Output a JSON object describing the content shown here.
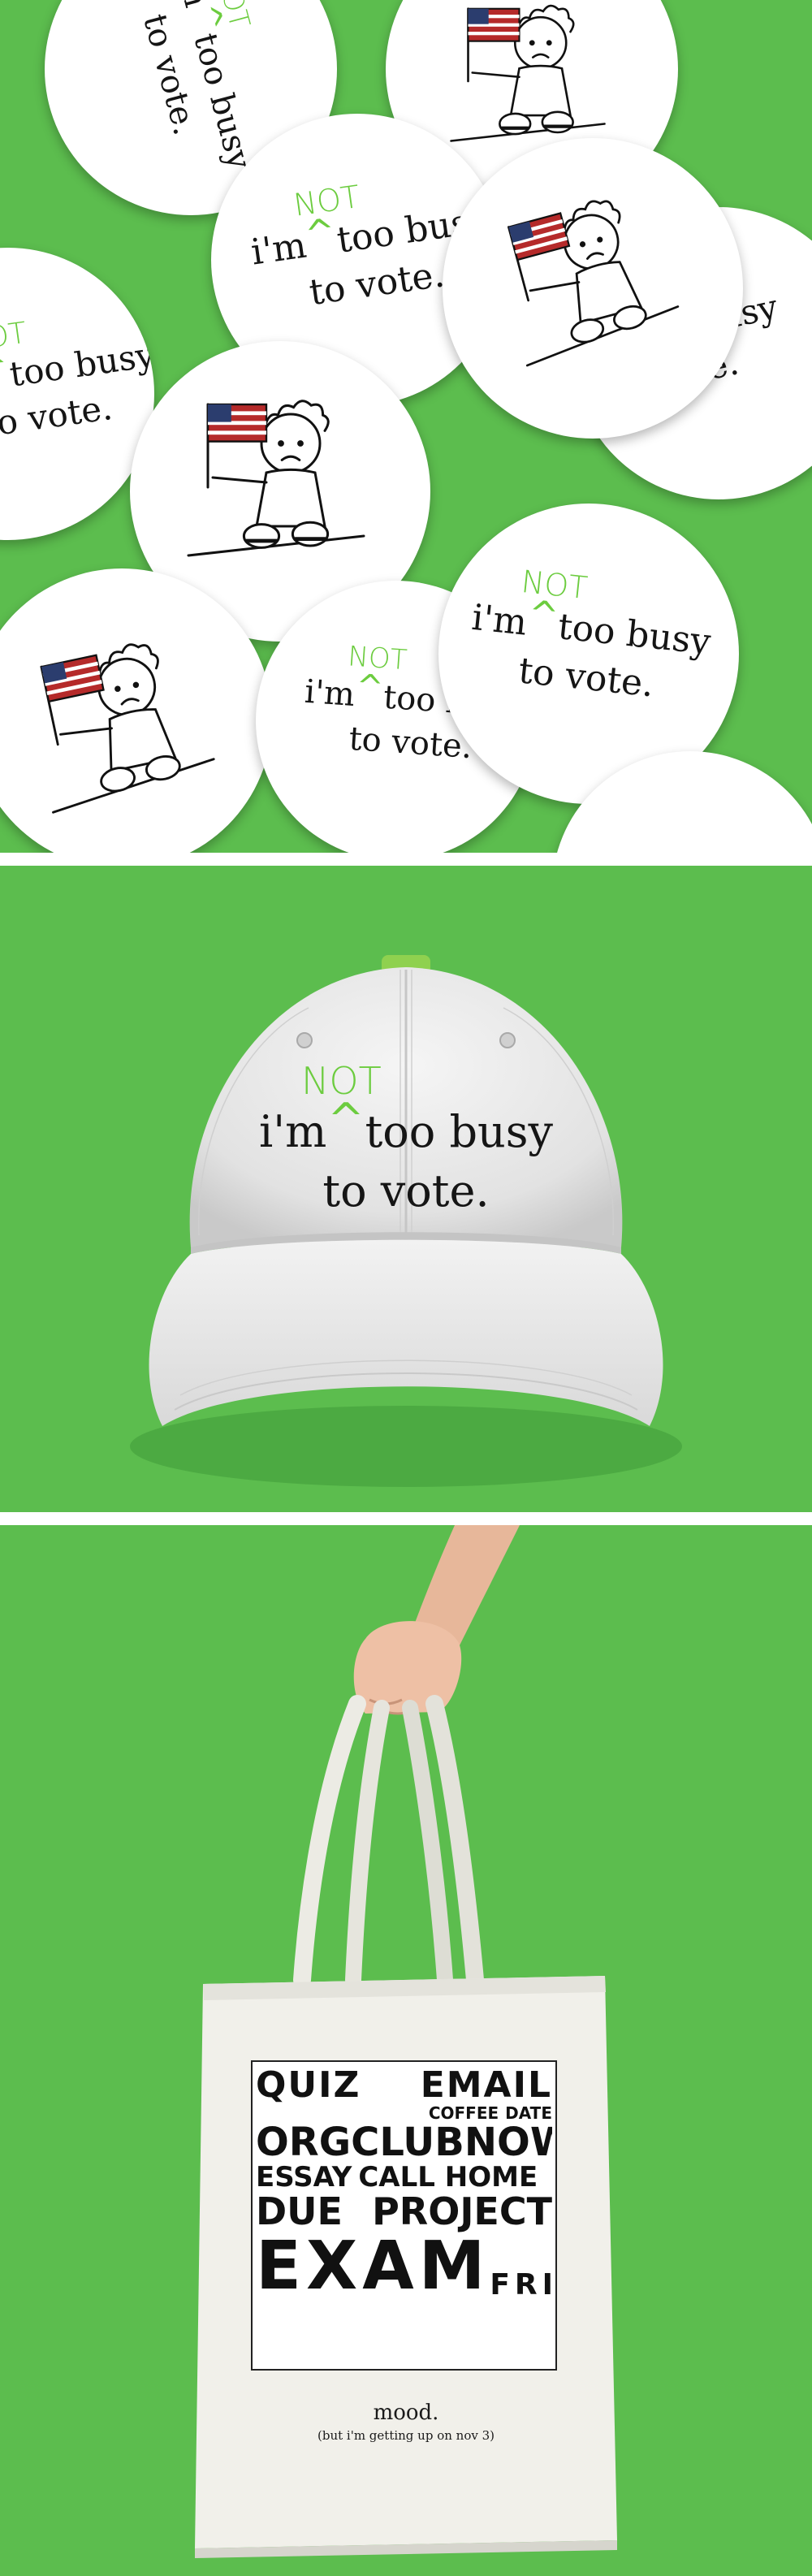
{
  "slogan": {
    "insert": "NOT",
    "line1_start": "i'm",
    "caret": "^",
    "line1_end": "too busy",
    "line2": "to vote."
  },
  "tote": {
    "collage_words": [
      "QUIZ",
      "EMAIL",
      "COFFEE",
      "DATE",
      "ORG",
      "CLUB",
      "NOW",
      "ESSAY",
      "CALL HOME",
      "DUE",
      "PROJECT",
      "EXAM",
      "FRI"
    ],
    "caption": "mood.",
    "subcaption": "(but i'm getting up on nov 3)"
  },
  "colors": {
    "background_green": "#5cbd4e",
    "accent_green": "#6ccc3f",
    "flag_red": "#b52a2a",
    "flag_blue": "#2b3d6e"
  },
  "icons": [
    "sad-kid-with-flag-icon",
    "american-flag-icon"
  ]
}
